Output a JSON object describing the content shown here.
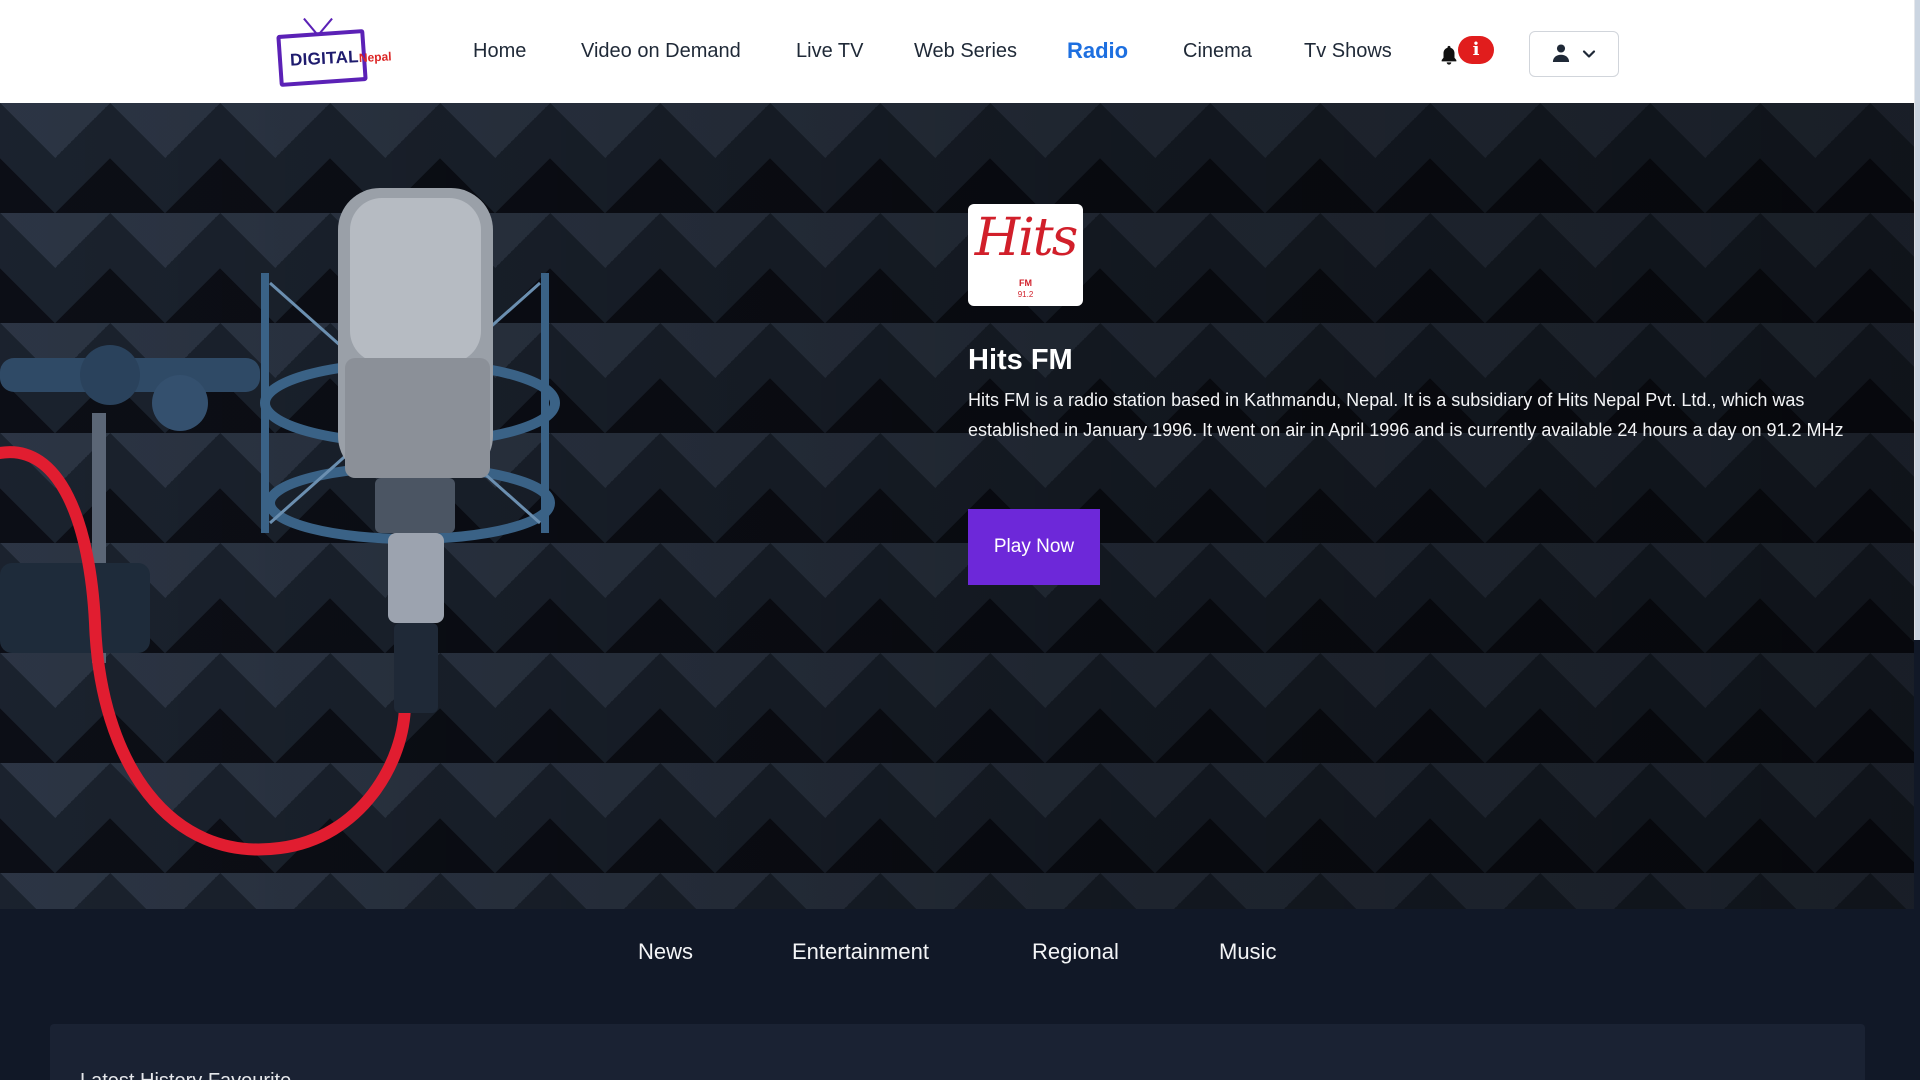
{
  "logo": {
    "word1": "DIGITAL",
    "word2": "Nepal"
  },
  "nav": {
    "items": [
      {
        "label": "Home"
      },
      {
        "label": "Video on Demand"
      },
      {
        "label": "Live TV"
      },
      {
        "label": "Web Series"
      },
      {
        "label": "Radio"
      },
      {
        "label": "Cinema"
      },
      {
        "label": "Tv Shows"
      }
    ],
    "active": "Radio",
    "notification_badge": "i"
  },
  "hero": {
    "station_logo": {
      "script": "Hits",
      "sub": "FM",
      "freq": "91.2"
    },
    "title": "Hits FM",
    "description": "Hits FM is a radio station based in Kathmandu, Nepal. It is a subsidiary of Hits Nepal Pvt. Ltd., which was established in January 1996. It went on air in April 1996 and is currently available 24 hours a day on 91.2 MHz",
    "play_label": "Play Now"
  },
  "categories": [
    {
      "label": "News"
    },
    {
      "label": "Entertainment"
    },
    {
      "label": "Regional"
    },
    {
      "label": "Music"
    }
  ],
  "section": {
    "title": "Latest  History  Favourite"
  },
  "colors": {
    "accent": "#6d28d9",
    "active_nav": "#1d6fe0",
    "badge": "#e11d1d",
    "background": "#111827"
  }
}
